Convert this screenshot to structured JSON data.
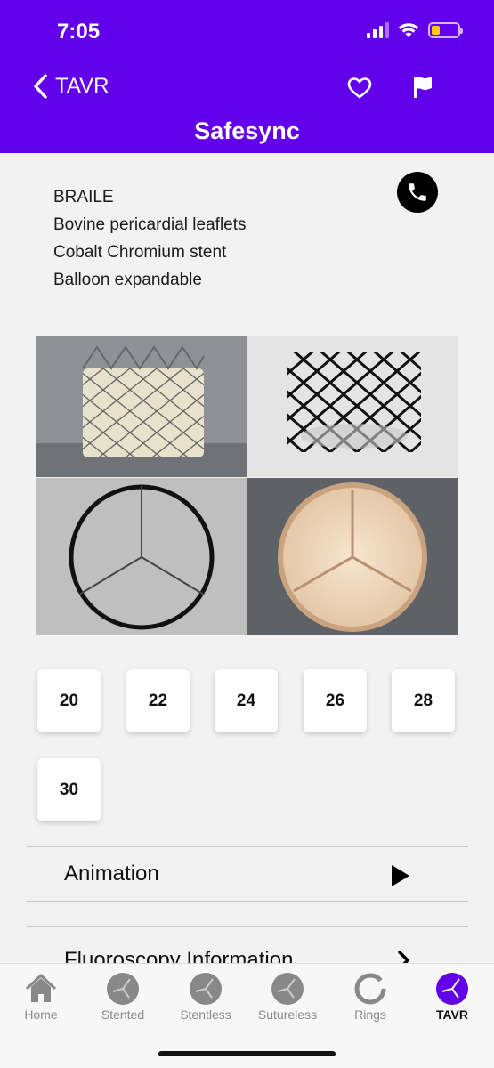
{
  "status_bar": {
    "time": "7:05"
  },
  "nav": {
    "back_label": "TAVR",
    "title": "Safesync"
  },
  "device_info": {
    "lines": [
      "BRAILE",
      "Bovine pericardial leaflets",
      "Cobalt Chromium stent",
      "Balloon expandable"
    ]
  },
  "sizes": [
    "20",
    "22",
    "24",
    "26",
    "28",
    "30"
  ],
  "rows": {
    "animation": "Animation",
    "fluoroscopy": "Fluoroscopy Information"
  },
  "tabs": [
    {
      "label": "Home",
      "icon": "home-icon"
    },
    {
      "label": "Stented",
      "icon": "stented-valve-icon"
    },
    {
      "label": "Stentless",
      "icon": "stentless-valve-icon"
    },
    {
      "label": "Sutureless",
      "icon": "sutureless-valve-icon"
    },
    {
      "label": "Rings",
      "icon": "ring-icon"
    },
    {
      "label": "TAVR",
      "icon": "tavr-icon",
      "active": true
    }
  ],
  "colors": {
    "brand": "#6200ea",
    "battery": "#ffcc00"
  }
}
